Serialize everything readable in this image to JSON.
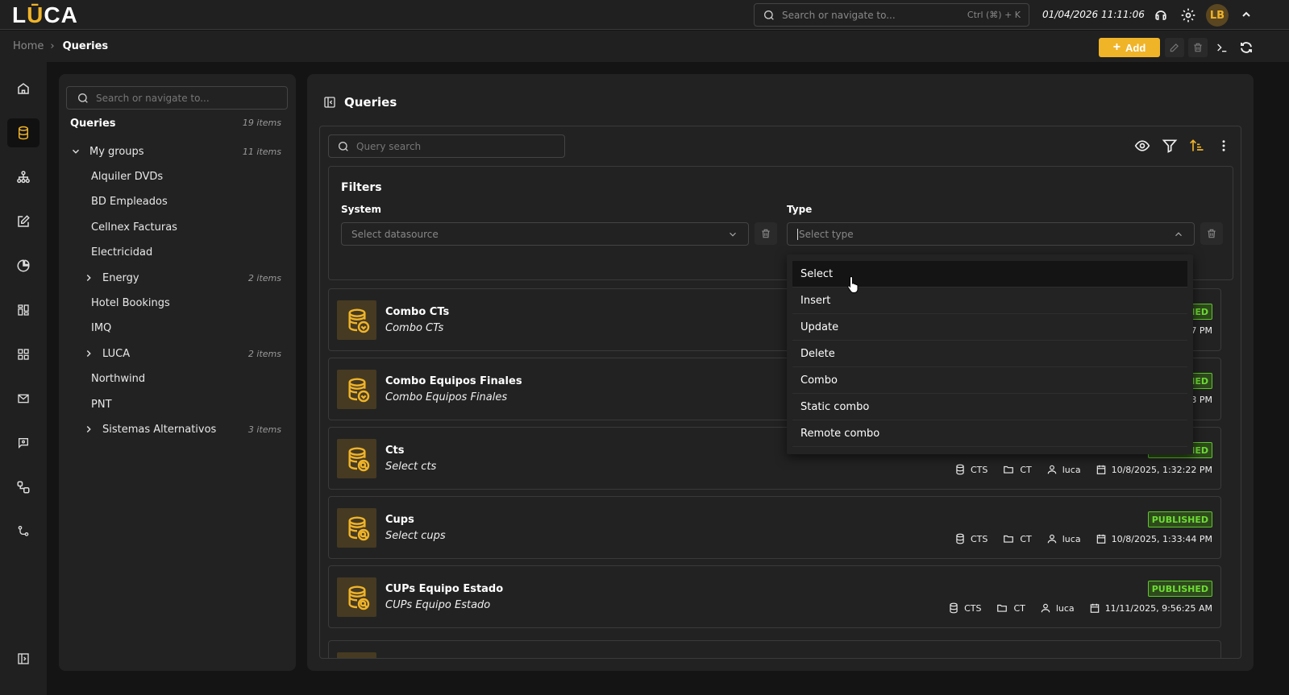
{
  "app": {
    "logo": "LUCA",
    "search_placeholder": "Search or navigate to...",
    "shortcut": "Ctrl (⌘) + K",
    "datetime": "01/04/2026 11:11:06",
    "avatar": "LB"
  },
  "breadcrumb": {
    "home": "Home",
    "current": "Queries"
  },
  "toolbar": {
    "add_label": "Add"
  },
  "rail": {
    "items": [
      "home-icon",
      "database-icon",
      "hierarchy-icon",
      "edit-icon",
      "pie-chart-icon",
      "dashboard-icon",
      "grid-icon",
      "mail-icon",
      "chat-icon",
      "workflow-icon",
      "branch-icon"
    ],
    "active": "database-icon"
  },
  "tree": {
    "search_placeholder": "Search or navigate to...",
    "title": "Queries",
    "count": "19 items",
    "items": [
      {
        "label": "My groups",
        "count": "11 items",
        "level": 0,
        "expander": "down"
      },
      {
        "label": "Alquiler DVDs",
        "level": 1
      },
      {
        "label": "BD Empleados",
        "level": 1
      },
      {
        "label": "Cellnex Facturas",
        "level": 1
      },
      {
        "label": "Electricidad",
        "level": 1
      },
      {
        "label": "Energy",
        "count": "2 items",
        "level": 1,
        "expander": "right"
      },
      {
        "label": "Hotel Bookings",
        "level": 1
      },
      {
        "label": "IMQ",
        "level": 1
      },
      {
        "label": "LUCA",
        "count": "2 items",
        "level": 1,
        "expander": "right"
      },
      {
        "label": "Northwind",
        "level": 1
      },
      {
        "label": "PNT",
        "level": 1
      },
      {
        "label": "Sistemas Alternativos",
        "count": "3 items",
        "level": 1,
        "expander": "right"
      }
    ]
  },
  "main": {
    "title": "Queries",
    "search_placeholder": "Query search",
    "filters": {
      "title": "Filters",
      "system_label": "System",
      "system_placeholder": "Select datasource",
      "type_label": "Type",
      "type_placeholder": "Select type"
    },
    "type_options": [
      "Select",
      "Insert",
      "Update",
      "Delete",
      "Combo",
      "Static combo",
      "Remote combo"
    ],
    "type_highlighted": "Select",
    "cards": [
      {
        "name": "Combo CTs",
        "desc": "Combo CTs",
        "icon": "combo",
        "status": "PUBLISHED",
        "date": "7 PM"
      },
      {
        "name": "Combo Equipos Finales",
        "desc": "Combo Equipos Finales",
        "icon": "combo",
        "status": "PUBLISHED",
        "date": "3 PM"
      },
      {
        "name": "Cts",
        "desc": "Select cts",
        "icon": "select",
        "status": "PUBLISHED",
        "datasource": "CTS",
        "folder": "CT",
        "user": "luca",
        "date": "10/8/2025, 1:32:22 PM"
      },
      {
        "name": "Cups",
        "desc": "Select cups",
        "icon": "select",
        "status": "PUBLISHED",
        "datasource": "CTS",
        "folder": "CT",
        "user": "luca",
        "date": "10/8/2025, 1:33:44 PM"
      },
      {
        "name": "CUPs Equipo Estado",
        "desc": "CUPs Equipo Estado",
        "icon": "select",
        "status": "PUBLISHED",
        "datasource": "CTS",
        "folder": "CT",
        "user": "luca",
        "date": "11/11/2025, 9:56:25 AM"
      }
    ]
  },
  "colors": {
    "accent": "#f0b429",
    "published": "#6ddc35",
    "background": "#141414",
    "panel": "#222222"
  }
}
